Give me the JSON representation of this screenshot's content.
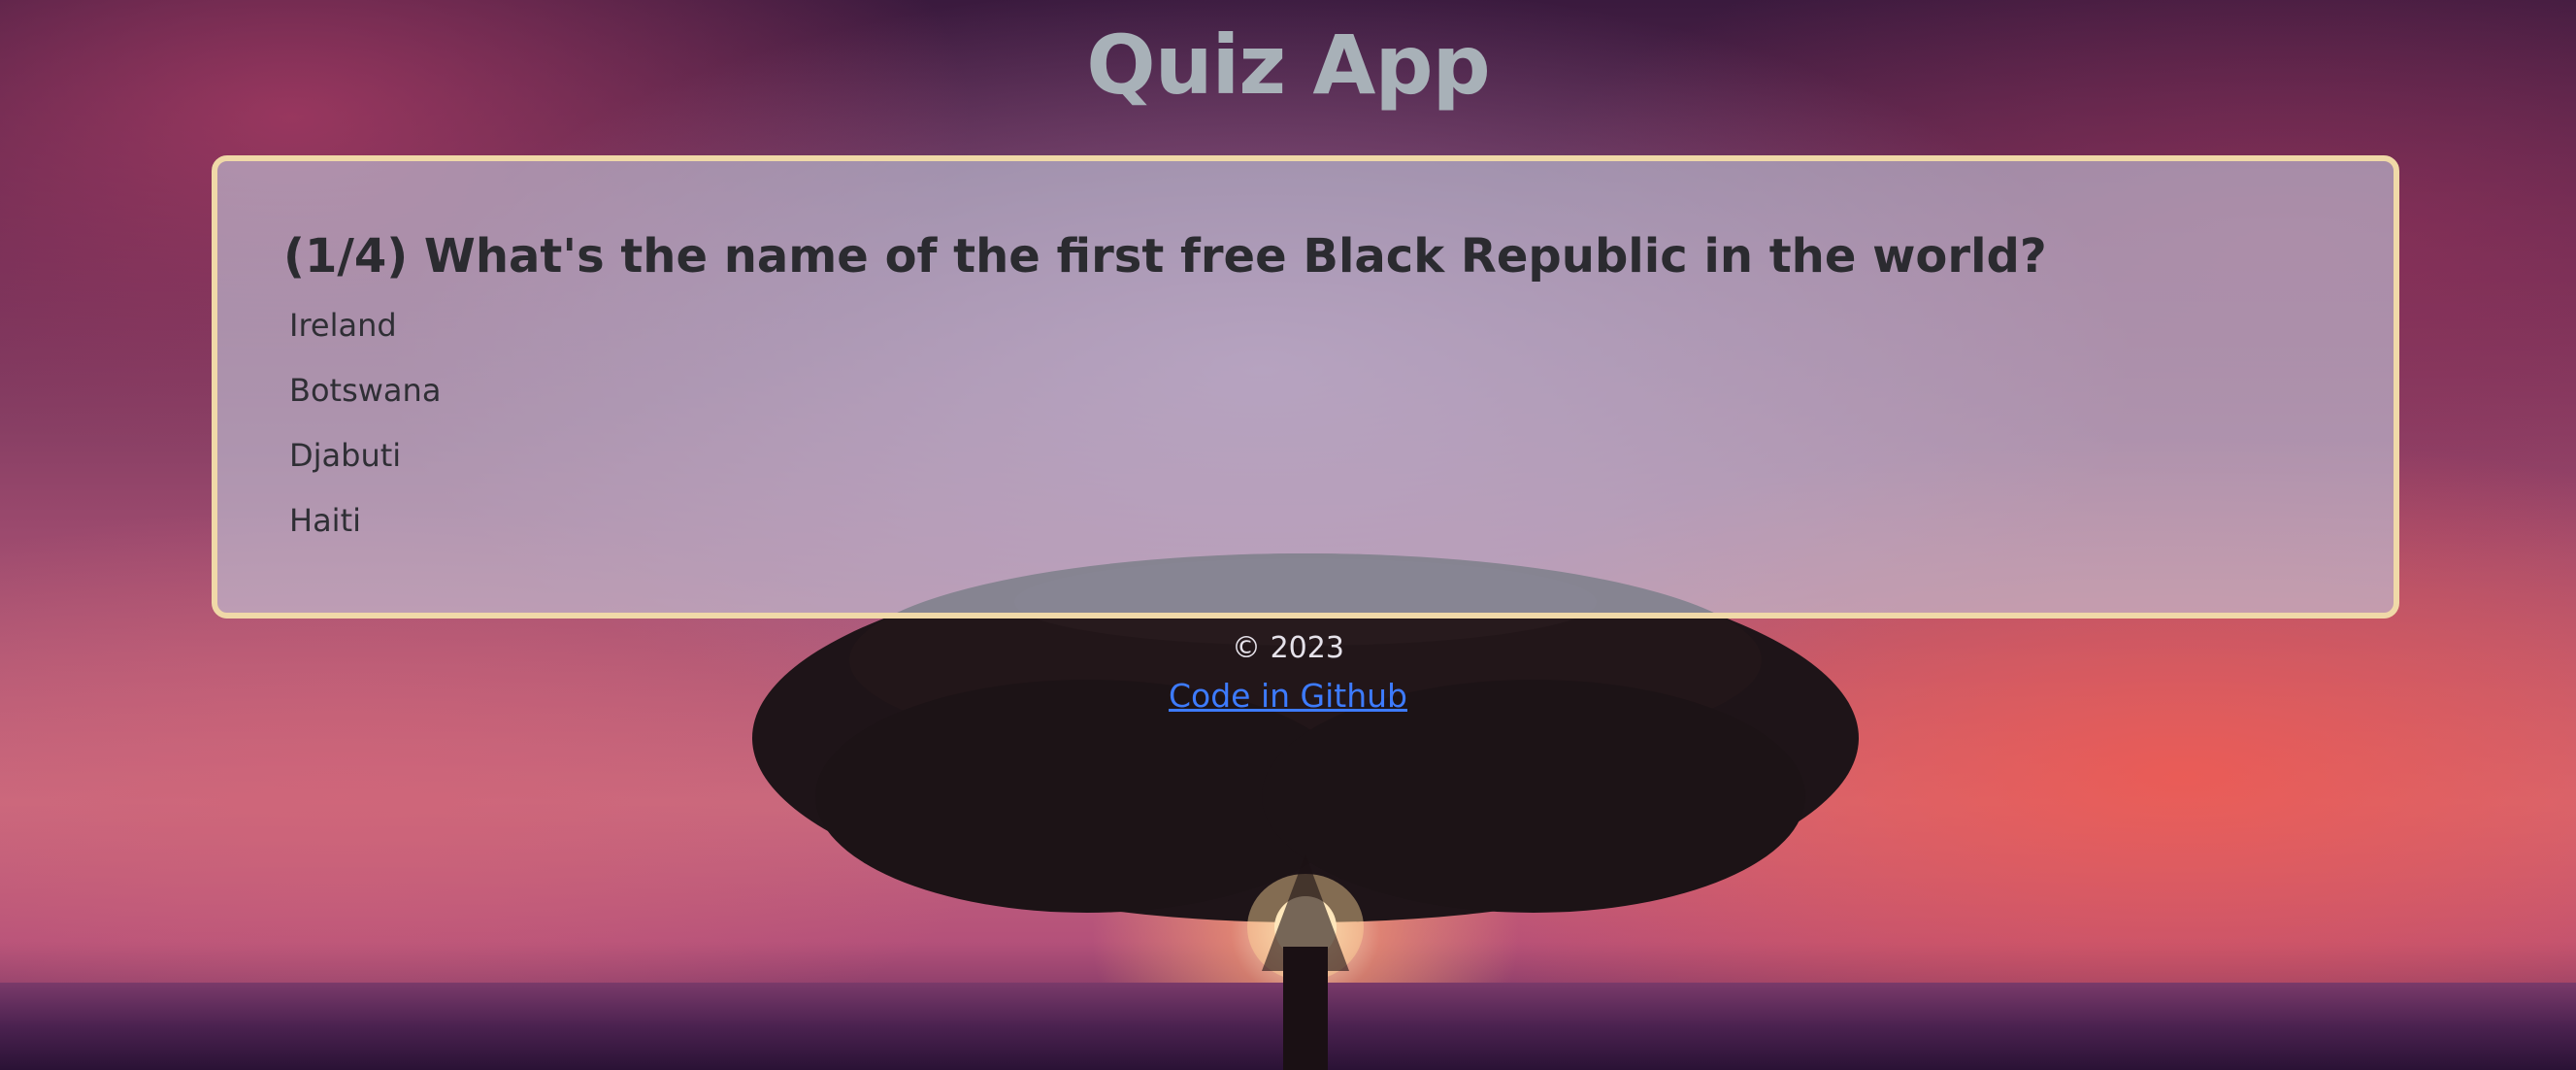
{
  "header": {
    "title": "Quiz App"
  },
  "quiz": {
    "question": "(1/4) What's the name of the first free Black Republic in the world?",
    "answers": [
      "Ireland",
      "Botswana",
      "Djabuti",
      "Haiti"
    ]
  },
  "footer": {
    "copyright": "© 2023",
    "github_link": "Code in Github"
  },
  "colors": {
    "card_border": "#f0d9a8",
    "title": "#a8b1b8",
    "link": "#3d7bff"
  }
}
